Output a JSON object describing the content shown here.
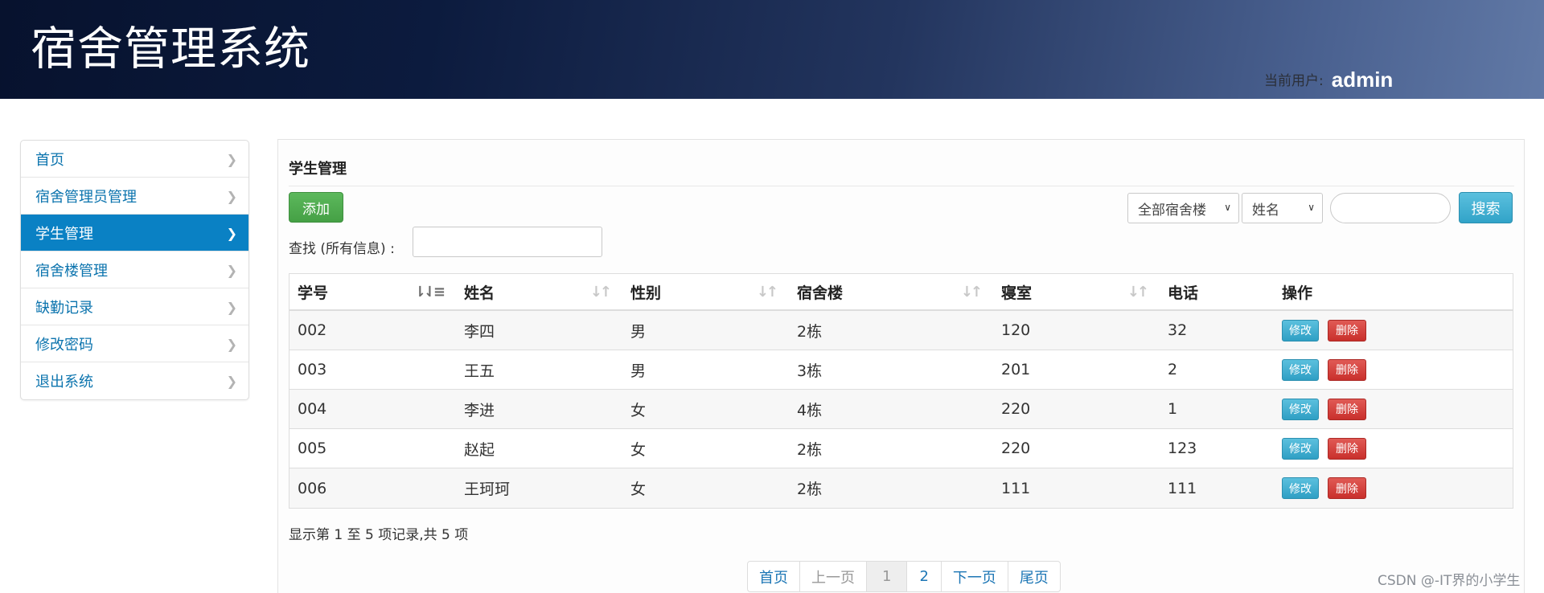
{
  "header": {
    "title": "宿舍管理系统",
    "user_label": "当前用户:",
    "user_name": "admin"
  },
  "sidebar": {
    "items": [
      {
        "label": "首页",
        "active": false
      },
      {
        "label": "宿舍管理员管理",
        "active": false
      },
      {
        "label": "学生管理",
        "active": true
      },
      {
        "label": "宿舍楼管理",
        "active": false
      },
      {
        "label": "缺勤记录",
        "active": false
      },
      {
        "label": "修改密码",
        "active": false
      },
      {
        "label": "退出系统",
        "active": false
      }
    ]
  },
  "main": {
    "title": "学生管理",
    "add_label": "添加",
    "building_select": "全部宿舍楼",
    "field_select": "姓名",
    "search_value": "",
    "search_label": "搜索",
    "find_label": "查找 (所有信息) :",
    "find_value": ""
  },
  "table": {
    "columns": [
      "学号",
      "姓名",
      "性别",
      "宿舍楼",
      "寝室",
      "电话",
      "操作"
    ],
    "rows": [
      [
        "002",
        "李四",
        "男",
        "2栋",
        "120",
        "32"
      ],
      [
        "003",
        "王五",
        "男",
        "3栋",
        "201",
        "2"
      ],
      [
        "004",
        "李进",
        "女",
        "4栋",
        "220",
        "1"
      ],
      [
        "005",
        "赵起",
        "女",
        "2栋",
        "220",
        "123"
      ],
      [
        "006",
        "王珂珂",
        "女",
        "2栋",
        "111",
        "111"
      ]
    ],
    "edit_label": "修改",
    "delete_label": "删除",
    "info": "显示第 1 至 5 项记录,共 5 项"
  },
  "pagination": {
    "first": "首页",
    "prev": "上一页",
    "pages": [
      "1",
      "2"
    ],
    "current": "1",
    "next": "下一页",
    "last": "尾页"
  },
  "watermark": "CSDN @-IT界的小学生"
}
